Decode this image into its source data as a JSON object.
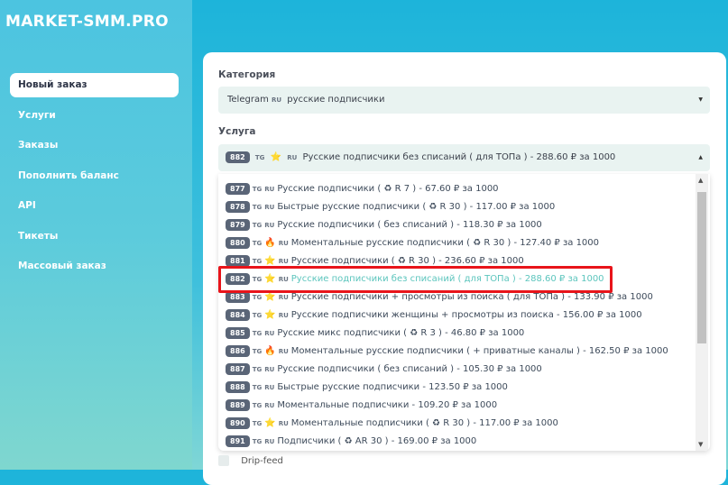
{
  "logo": "MARKET-SMM.PRO",
  "nav": [
    "Новый заказ",
    "Услуги",
    "Заказы",
    "Пополнить баланс",
    "API",
    "Тикеты",
    "Массовый заказ"
  ],
  "category": {
    "label": "Категория",
    "value": "Telegram",
    "value_tag": "RU",
    "value_rest": "русские подписчики"
  },
  "service": {
    "label": "Услуга",
    "selected": {
      "id": "882",
      "emoji": "⭐",
      "text": "Русские подписчики без списаний ( для ТОПа ) - 288.60 ₽ за 1000"
    }
  },
  "options": [
    {
      "id": "877",
      "emoji": "",
      "text": "Русские подписчики ( ♻ R 7 ) - 67.60 ₽ за 1000"
    },
    {
      "id": "878",
      "emoji": "",
      "text": "Быстрые русские подписчики ( ♻ R 30 ) - 117.00 ₽ за 1000"
    },
    {
      "id": "879",
      "emoji": "",
      "text": "Русские подписчики ( без списаний ) - 118.30 ₽ за 1000"
    },
    {
      "id": "880",
      "emoji": "🔥",
      "text": "Моментальные русские подписчики ( ♻ R 30 ) - 127.40 ₽ за 1000"
    },
    {
      "id": "881",
      "emoji": "⭐",
      "text": "Русские подписчики ( ♻ R 30 ) - 236.60 ₽ за 1000"
    },
    {
      "id": "882",
      "emoji": "⭐",
      "text": "Русские подписчики без списаний ( для ТОПа ) - 288.60 ₽ за 1000"
    },
    {
      "id": "883",
      "emoji": "⭐",
      "text": "Русские подписчики + просмотры из поиска ( для ТОПа ) - 133.90 ₽ за 1000"
    },
    {
      "id": "884",
      "emoji": "⭐",
      "text": "Русские подписчики женщины + просмотры из поиска - 156.00 ₽ за 1000"
    },
    {
      "id": "885",
      "emoji": "",
      "text": "Русские микс подписчики ( ♻ R 3 ) - 46.80 ₽ за 1000"
    },
    {
      "id": "886",
      "emoji": "🔥",
      "text": "Моментальные русские подписчики ( + приватные каналы ) - 162.50 ₽ за 1000"
    },
    {
      "id": "887",
      "emoji": "",
      "text": "Русские подписчики ( без списаний ) - 105.30 ₽ за 1000"
    },
    {
      "id": "888",
      "emoji": "",
      "text": "Быстрые русские подписчики - 123.50 ₽ за 1000"
    },
    {
      "id": "889",
      "emoji": "",
      "text": "Моментальные подписчики - 109.20 ₽ за 1000"
    },
    {
      "id": "890",
      "emoji": "⭐",
      "text": "Моментальные подписчики ( ♻ R 30 ) - 117.00 ₽ за 1000"
    },
    {
      "id": "891",
      "emoji": "",
      "text": "Подписчики ( ♻ AR 30 ) - 169.00 ₽ за 1000"
    }
  ],
  "tg": "TG",
  "ru": "RU",
  "drip_feed": "Drip-feed"
}
